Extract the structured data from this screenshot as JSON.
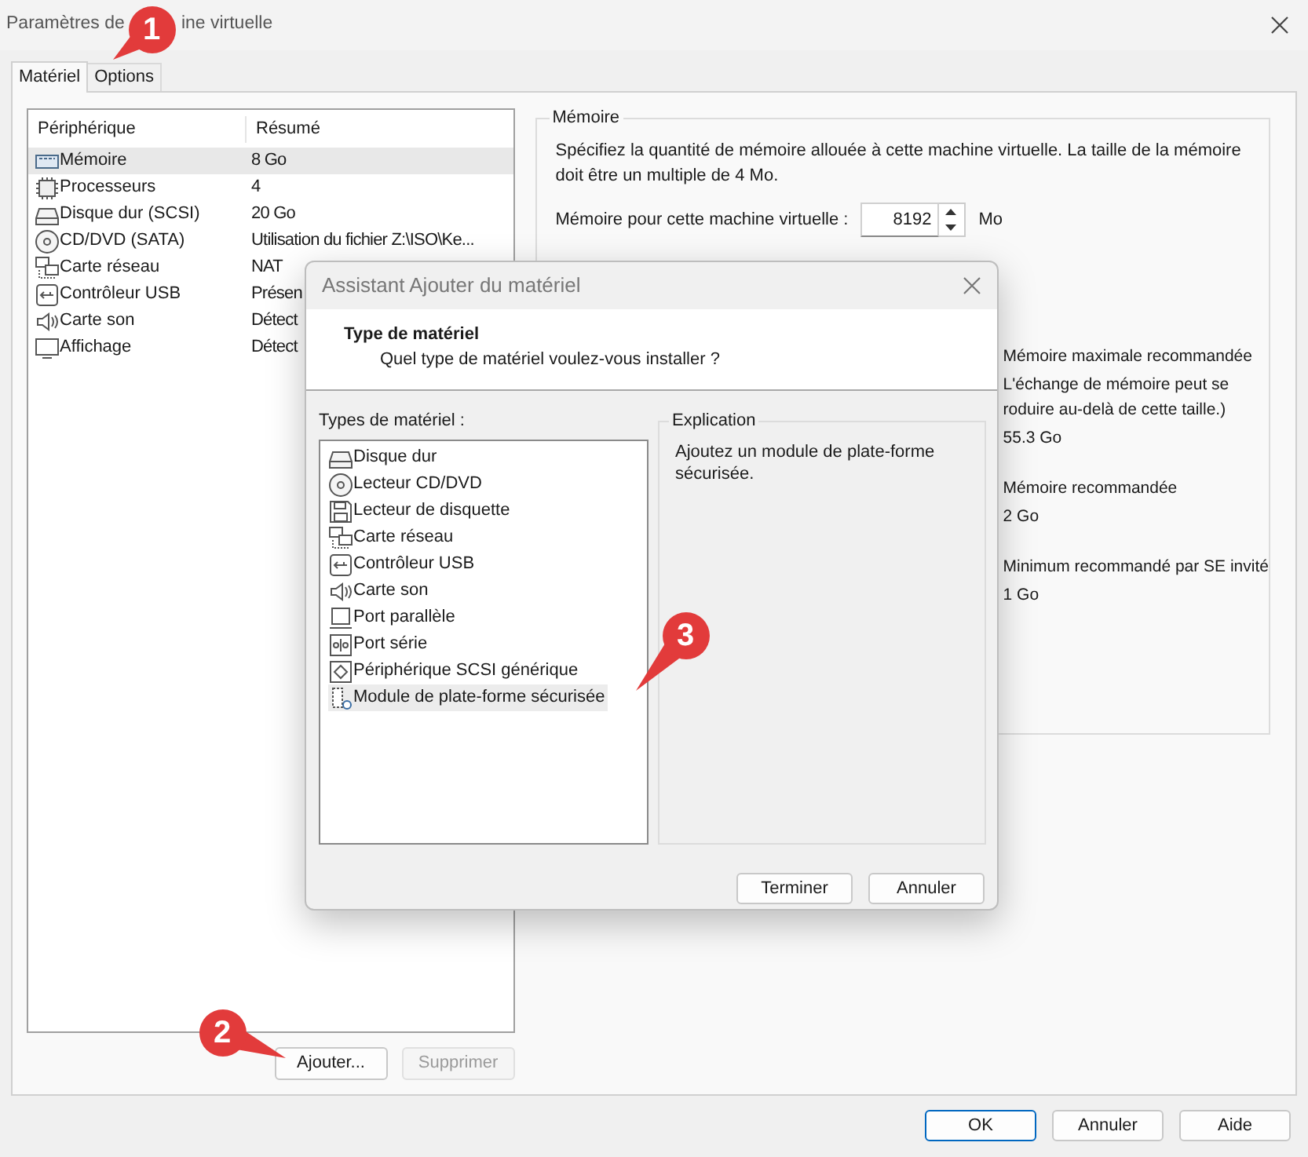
{
  "window": {
    "title_parts": [
      "Paramètres de",
      "ine virtuelle"
    ]
  },
  "tabs": [
    {
      "label": "Matériel",
      "selected": true
    },
    {
      "label": "Options",
      "selected": false
    }
  ],
  "devices": {
    "columns": [
      "Périphérique",
      "Résumé"
    ],
    "rows": [
      {
        "kind": "memory",
        "name": "Mémoire",
        "summary": "8 Go",
        "selected": true
      },
      {
        "kind": "cpu",
        "name": "Processeurs",
        "summary": "4",
        "selected": false
      },
      {
        "kind": "disk",
        "name": "Disque dur (SCSI)",
        "summary": "20 Go",
        "selected": false
      },
      {
        "kind": "cd",
        "name": "CD/DVD (SATA)",
        "summary": "Utilisation du fichier Z:\\ISO\\Ke...",
        "selected": false
      },
      {
        "kind": "network",
        "name": "Carte réseau",
        "summary": "NAT",
        "selected": false
      },
      {
        "kind": "usb",
        "name": "Contrôleur USB",
        "summary": "Présen",
        "selected": false
      },
      {
        "kind": "sound",
        "name": "Carte son",
        "summary": "Détect",
        "selected": false
      },
      {
        "kind": "display",
        "name": "Affichage",
        "summary": "Détect",
        "selected": false
      }
    ]
  },
  "device_buttons": [
    {
      "label": "Ajouter...",
      "disabled": false
    },
    {
      "label": "Supprimer",
      "disabled": true
    }
  ],
  "memory": {
    "title": "Mémoire",
    "description": "Spécifiez la quantité de mémoire allouée à cette machine virtuelle. La taille de la mémoire doit être un multiple de 4 Mo.",
    "field_label": "Mémoire pour cette machine virtuelle :",
    "value": "8192",
    "unit": "Mo",
    "notes": [
      "Mémoire maximale recommandée",
      "L'échange de mémoire peut se",
      "roduire au-delà de cette taille.)",
      "55.3 Go",
      "Mémoire recommandée",
      "2 Go",
      "Minimum recommandé par SE invité",
      "1 Go"
    ]
  },
  "footer_buttons": [
    {
      "label": "OK",
      "default": true
    },
    {
      "label": "Annuler",
      "default": false
    },
    {
      "label": "Aide",
      "default": false
    }
  ],
  "dialog": {
    "title": "Assistant Ajouter du matériel",
    "heading": "Type de matériel",
    "subheading": "Quel type de matériel voulez-vous installer ?",
    "list_label": "Types de matériel :",
    "types": [
      {
        "kind": "disk",
        "label": "Disque dur",
        "selected": false
      },
      {
        "kind": "cd",
        "label": "Lecteur CD/DVD",
        "selected": false
      },
      {
        "kind": "floppy",
        "label": "Lecteur de disquette",
        "selected": false
      },
      {
        "kind": "network",
        "label": "Carte réseau",
        "selected": false
      },
      {
        "kind": "usb",
        "label": "Contrôleur USB",
        "selected": false
      },
      {
        "kind": "sound",
        "label": "Carte son",
        "selected": false
      },
      {
        "kind": "parallel",
        "label": "Port parallèle",
        "selected": false
      },
      {
        "kind": "serial",
        "label": "Port série",
        "selected": false
      },
      {
        "kind": "scsi",
        "label": "Périphérique SCSI générique",
        "selected": false
      },
      {
        "kind": "tpm",
        "label": "Module de plate-forme sécurisée",
        "selected": true
      }
    ],
    "explanation_title": "Explication",
    "explanation": "Ajoutez un module de plate-forme sécurisée.",
    "buttons": [
      "Terminer",
      "Annuler"
    ]
  },
  "callouts": [
    "1",
    "2",
    "3"
  ]
}
